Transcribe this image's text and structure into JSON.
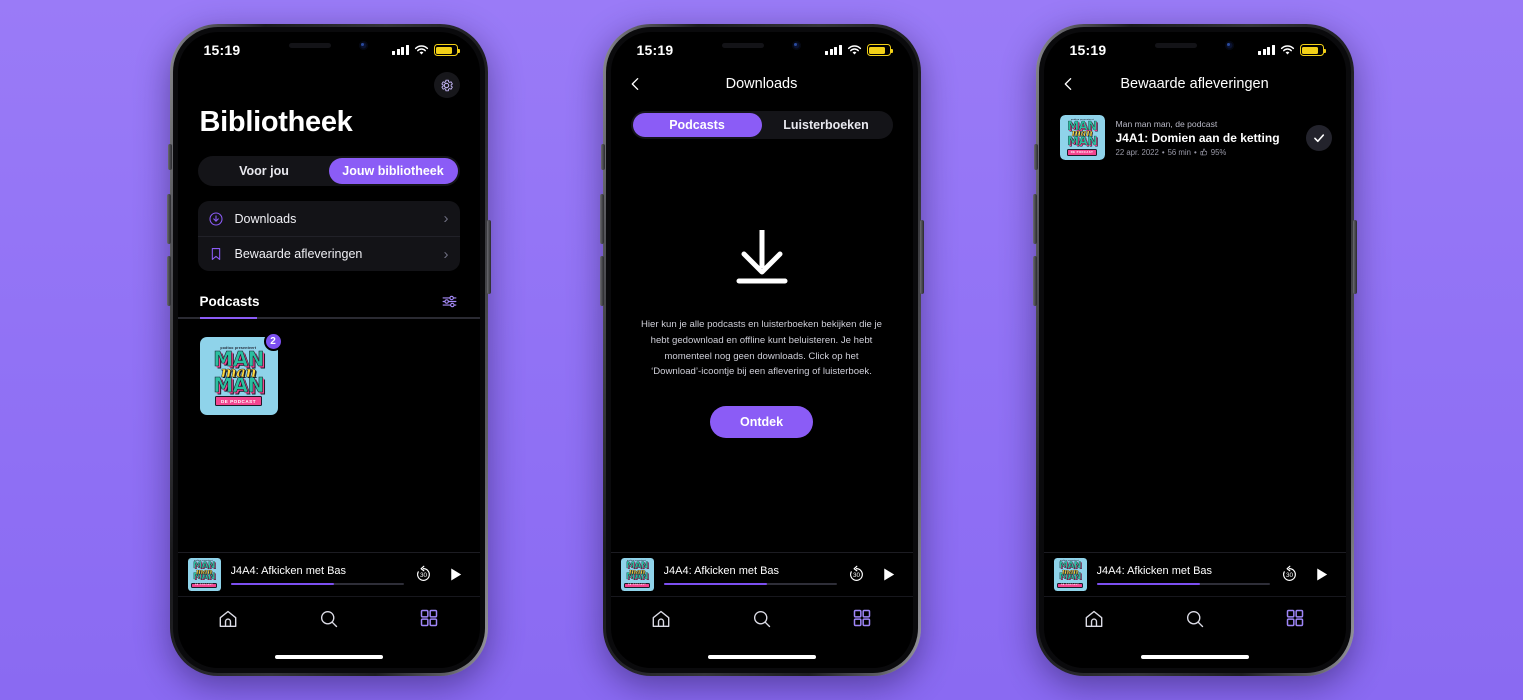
{
  "statusbar": {
    "time": "15:19",
    "signal_icon": "cellular-signal-icon",
    "wifi_icon": "wifi-icon",
    "battery_icon": "battery-low-power-icon"
  },
  "phone1": {
    "settings_icon": "gear-icon",
    "title": "Bibliotheek",
    "segments": [
      {
        "label": "Voor jou",
        "active": false
      },
      {
        "label": "Jouw bibliotheek",
        "active": true
      }
    ],
    "menu": [
      {
        "label": "Downloads",
        "icon": "download-circle-icon",
        "chevron": "›"
      },
      {
        "label": "Bewaarde afleveringen",
        "icon": "bookmark-icon",
        "chevron": "›"
      }
    ],
    "section_title": "Podcasts",
    "filter_icon": "sliders-filter-icon",
    "podcasts": [
      {
        "title_line1": "MAN",
        "title_line2": "man",
        "title_line3": "MAN",
        "pretitle": "podtoo presenteert",
        "banner": "DE PODCAST",
        "badge": "2"
      }
    ]
  },
  "phone2": {
    "back_icon": "back-chevron-icon",
    "title": "Downloads",
    "segments": [
      {
        "label": "Podcasts",
        "active": true
      },
      {
        "label": "Luisterboeken",
        "active": false
      }
    ],
    "empty_icon": "download-arrow-icon",
    "empty_text": "Hier kun je alle podcasts en luisterboeken bekijken die je hebt gedownload en offline kunt beluisteren. Je hebt momenteel nog geen downloads. Click op het ‘Download’-icoontje bij een aflevering of luisterboek.",
    "cta_label": "Ontdek"
  },
  "phone3": {
    "back_icon": "back-chevron-icon",
    "title": "Bewaarde afleveringen",
    "episodes": [
      {
        "show": "Man man man, de podcast",
        "name": "J4A1: Domien aan de ketting",
        "date": "22 apr. 2022",
        "duration": "56 min",
        "rating": "95%",
        "separator": "•",
        "thumb_icon": "thumbs-up-icon",
        "check_icon": "check-icon"
      }
    ]
  },
  "miniplayer": {
    "track": "J4A4: Afkicken met Bas",
    "progress_percent": 60,
    "rewind_icon": "rewind-30-icon",
    "rewind_label": "30",
    "play_icon": "play-icon",
    "art_icon": "podcast-artwork"
  },
  "tabbar": {
    "items": [
      {
        "icon": "home-icon",
        "active": false
      },
      {
        "icon": "search-icon",
        "active": false
      },
      {
        "icon": "grid-icon",
        "active": true
      }
    ]
  },
  "cover_art": {
    "pretitle": "podtoo presenteert",
    "line1": "MAN",
    "line2": "man",
    "line3": "MAN",
    "banner": "DE PODCAST"
  },
  "colors": {
    "accent": "#8b5cf6",
    "accent_bright": "#7c4ff0",
    "background_purple": "#9575f5",
    "screen_black": "#000000",
    "card": "#131317",
    "battery_yellow": "#f2d017",
    "cover_blue": "#8fd3ea",
    "cover_teal": "#2bbfa0",
    "cover_pink": "#f2458f",
    "cover_yellow": "#ffd93d"
  }
}
